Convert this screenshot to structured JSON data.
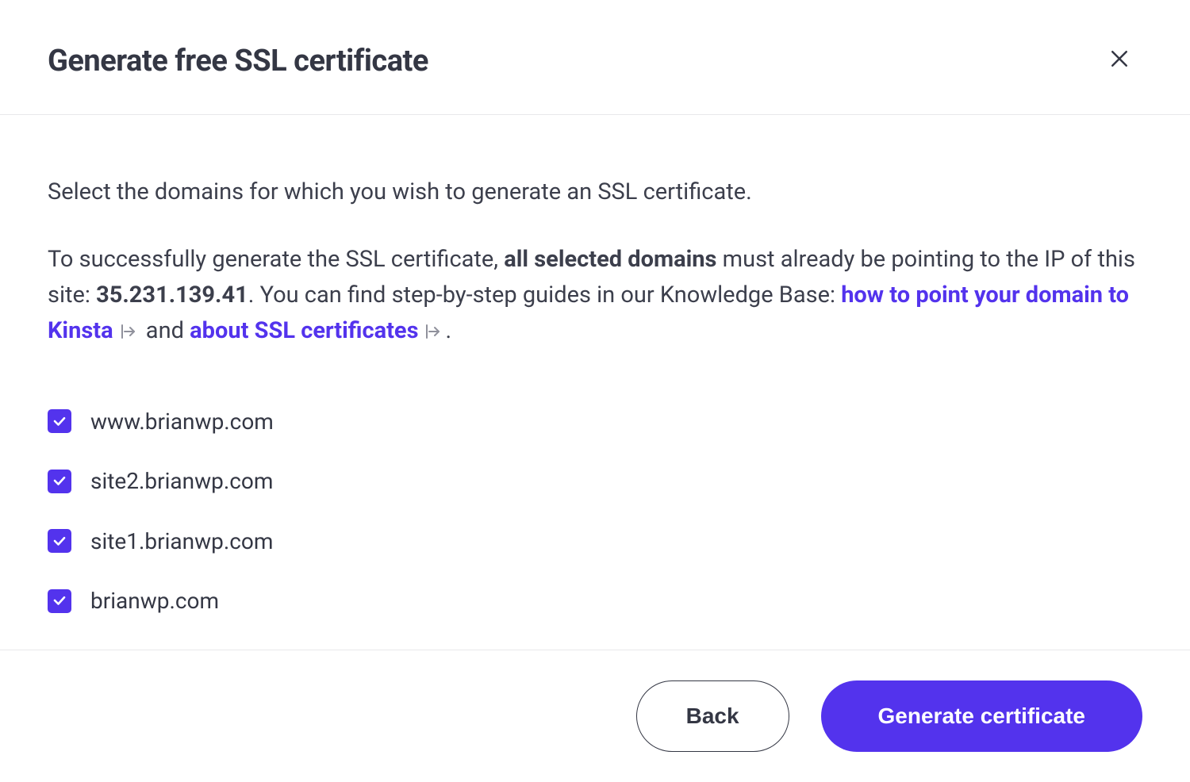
{
  "header": {
    "title": "Generate free SSL certificate"
  },
  "body": {
    "instruction1": "Select the domains for which you wish to generate an SSL certificate.",
    "instruction2_pre": "To successfully generate the SSL certificate, ",
    "instruction2_bold": "all selected domains",
    "instruction2_mid": " must already be pointing to the IP of this site: ",
    "ip": "35.231.139.41",
    "instruction2_post_ip": ". You can find step-by-step guides in our Knowledge Base: ",
    "link1": "how to point your domain to Kinsta",
    "and_text": " and ",
    "link2": "about SSL certificates",
    "period": "."
  },
  "domains": [
    {
      "label": "www.brianwp.com",
      "checked": true
    },
    {
      "label": "site2.brianwp.com",
      "checked": true
    },
    {
      "label": "site1.brianwp.com",
      "checked": true
    },
    {
      "label": "brianwp.com",
      "checked": true
    }
  ],
  "footer": {
    "back_label": "Back",
    "generate_label": "Generate certificate"
  }
}
